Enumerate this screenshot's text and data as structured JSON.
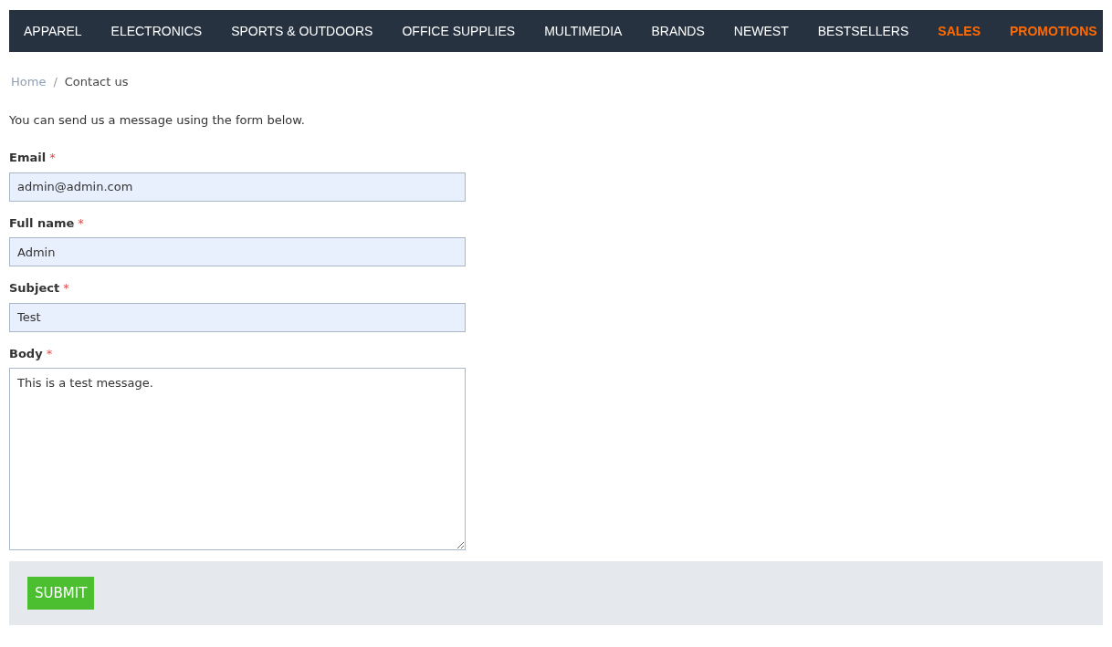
{
  "nav": {
    "items": [
      {
        "label": "APPAREL",
        "highlighted": false
      },
      {
        "label": "ELECTRONICS",
        "highlighted": false
      },
      {
        "label": "SPORTS & OUTDOORS",
        "highlighted": false
      },
      {
        "label": "OFFICE SUPPLIES",
        "highlighted": false
      },
      {
        "label": "MULTIMEDIA",
        "highlighted": false
      },
      {
        "label": "BRANDS",
        "highlighted": false
      },
      {
        "label": "NEWEST",
        "highlighted": false
      },
      {
        "label": "BESTSELLERS",
        "highlighted": false
      },
      {
        "label": "SALES",
        "highlighted": true
      },
      {
        "label": "PROMOTIONS",
        "highlighted": true
      }
    ]
  },
  "breadcrumb": {
    "items": [
      {
        "label": "Home",
        "link": true
      },
      {
        "label": "Contact us",
        "link": false
      }
    ],
    "separator": "/"
  },
  "intro": "You can send us a message using the form below.",
  "form": {
    "fields": [
      {
        "label": "Email",
        "required": true,
        "kind": "input",
        "value": "admin@admin.com",
        "autofilled": true
      },
      {
        "label": "Full name",
        "required": true,
        "kind": "input",
        "value": "Admin",
        "autofilled": true
      },
      {
        "label": "Subject",
        "required": true,
        "kind": "input",
        "value": "Test",
        "autofilled": true
      },
      {
        "label": "Body",
        "required": true,
        "kind": "textarea",
        "value": "This is a test message.",
        "autofilled": false
      }
    ],
    "required_mark": "*",
    "submit": "SUBMIT"
  }
}
